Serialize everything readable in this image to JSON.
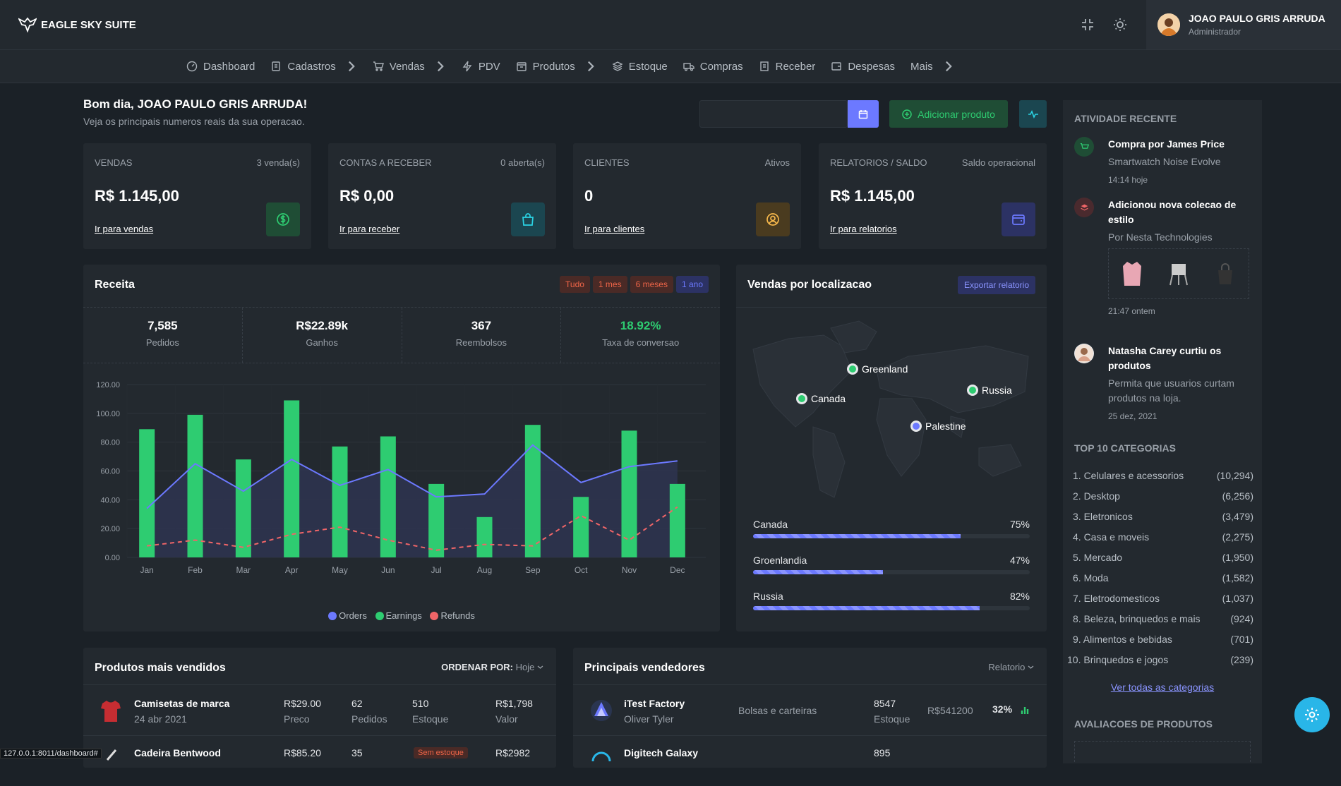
{
  "app": {
    "name": "EAGLE SKY SUITE"
  },
  "user": {
    "name": "JOAO PAULO GRIS ARRUDA",
    "role": "Administrador"
  },
  "nav": [
    {
      "label": "Dashboard",
      "icon": "gauge-icon",
      "sub": false
    },
    {
      "label": "Cadastros",
      "icon": "clipboard-icon",
      "sub": true
    },
    {
      "label": "Vendas",
      "icon": "cart-icon",
      "sub": true
    },
    {
      "label": "PDV",
      "icon": "bolt-icon",
      "sub": false
    },
    {
      "label": "Produtos",
      "icon": "box-icon",
      "sub": true
    },
    {
      "label": "Estoque",
      "icon": "layers-icon",
      "sub": false
    },
    {
      "label": "Compras",
      "icon": "truck-icon",
      "sub": false
    },
    {
      "label": "Receber",
      "icon": "receipt-icon",
      "sub": false
    },
    {
      "label": "Despesas",
      "icon": "wallet-icon",
      "sub": false
    },
    {
      "label": "Mais",
      "icon": "",
      "sub": true
    }
  ],
  "greeting": {
    "title": "Bom dia, JOAO PAULO GRIS ARRUDA!",
    "subtitle": "Veja os principais numeros reais da sua operacao."
  },
  "actions": {
    "add_product": "Adicionar produto"
  },
  "stats": [
    {
      "label": "VENDAS",
      "sub": "3 venda(s)",
      "value": "R$ 1.145,00",
      "link": "Ir para vendas",
      "icon": "dollar-icon",
      "color": "#2ecc71",
      "bg": "#1f4d35"
    },
    {
      "label": "CONTAS A RECEBER",
      "sub": "0 aberta(s)",
      "value": "R$ 0,00",
      "link": "Ir para receber",
      "icon": "bag-icon",
      "color": "#2bd3e4",
      "bg": "#1b4650"
    },
    {
      "label": "CLIENTES",
      "sub": "Ativos",
      "value": "0",
      "link": "Ir para clientes",
      "icon": "user-circle-icon",
      "color": "#f7b84b",
      "bg": "#4a3b1f"
    },
    {
      "label": "RELATORIOS / SALDO",
      "sub": "Saldo operacional",
      "value": "R$ 1.145,00",
      "link": "Ir para relatorios",
      "icon": "wallet-icon",
      "color": "#6c79ff",
      "bg": "#2c3264"
    }
  ],
  "revenue": {
    "title": "Receita",
    "filters": [
      {
        "label": "Tudo",
        "c": "#f06548",
        "bg": "#4a2a26"
      },
      {
        "label": "1 mes",
        "c": "#f06548",
        "bg": "#4a2a26"
      },
      {
        "label": "6 meses",
        "c": "#f06548",
        "bg": "#4a2a26"
      },
      {
        "label": "1 ano",
        "c": "#6c79ff",
        "bg": "#2c3264"
      }
    ],
    "kpis": [
      {
        "value": "7,585",
        "label": "Pedidos"
      },
      {
        "value": "R$22.89k",
        "label": "Ganhos"
      },
      {
        "value": "367",
        "label": "Reembolsos"
      },
      {
        "value": "18.92%",
        "label": "Taxa de conversao",
        "accent": true
      }
    ]
  },
  "chart_data": {
    "type": "bar",
    "categories": [
      "Jan",
      "Feb",
      "Mar",
      "Apr",
      "May",
      "Jun",
      "Jul",
      "Aug",
      "Sep",
      "Oct",
      "Nov",
      "Dec"
    ],
    "ylim": [
      0,
      120
    ],
    "yticks": [
      "0.00",
      "20.00",
      "40.00",
      "60.00",
      "80.00",
      "100.00",
      "120.00"
    ],
    "series": [
      {
        "name": "Orders",
        "type": "area",
        "color": "#6c79ff",
        "values": [
          34,
          65,
          46,
          68,
          50,
          61,
          42,
          44,
          78,
          52,
          63,
          67
        ]
      },
      {
        "name": "Earnings",
        "type": "bar",
        "color": "#2ecc71",
        "values": [
          89,
          99,
          68,
          109,
          77,
          84,
          51,
          28,
          92,
          42,
          88,
          51
        ]
      },
      {
        "name": "Refunds",
        "type": "line-dashed",
        "color": "#f06568",
        "values": [
          8,
          12,
          7,
          16,
          21,
          12,
          5,
          9,
          8,
          29,
          12,
          35
        ]
      }
    ]
  },
  "location": {
    "title": "Vendas por localizacao",
    "export": "Exportar relatorio",
    "markers": [
      "Greenland",
      "Canada",
      "Russia",
      "Palestine"
    ],
    "rows": [
      {
        "name": "Canada",
        "pct": "75%",
        "v": 0.75
      },
      {
        "name": "Groenlandia",
        "pct": "47%",
        "v": 0.47
      },
      {
        "name": "Russia",
        "pct": "82%",
        "v": 0.82
      }
    ]
  },
  "activity": {
    "title": "ATIVIDADE RECENTE",
    "items": [
      {
        "head": "Compra por James Price",
        "desc": "Smartwatch Noise Evolve",
        "time": "14:14 hoje"
      },
      {
        "head": "Adicionou nova colecao de estilo",
        "desc": "Por Nesta Technologies",
        "time": "21:47 ontem"
      },
      {
        "head": "Natasha Carey curtiu os produtos",
        "desc": "Permita que usuarios curtam produtos na loja.",
        "time": "25 dez, 2021"
      }
    ]
  },
  "categories": {
    "title": "TOP 10 CATEGORIAS",
    "items": [
      {
        "name": "1. Celulares e acessorios",
        "count": "(10,294)"
      },
      {
        "name": "2. Desktop",
        "count": "(6,256)"
      },
      {
        "name": "3. Eletronicos",
        "count": "(3,479)"
      },
      {
        "name": "4. Casa e moveis",
        "count": "(2,275)"
      },
      {
        "name": "5. Mercado",
        "count": "(1,950)"
      },
      {
        "name": "6. Moda",
        "count": "(1,582)"
      },
      {
        "name": "7. Eletrodomesticos",
        "count": "(1,037)"
      },
      {
        "name": "8. Beleza, brinquedos e mais",
        "count": "(924)"
      },
      {
        "name": "9. Alimentos e bebidas",
        "count": "(701)"
      },
      {
        "name": "10. Brinquedos e jogos",
        "count": "(239)"
      }
    ],
    "all": "Ver todas as categorias"
  },
  "reviews": {
    "title": "AVALIACOES DE PRODUTOS"
  },
  "products": {
    "title": "Produtos mais vendidos",
    "sort_label": "ORDENAR POR:",
    "sort_value": "Hoje",
    "rows": [
      {
        "name": "Camisetas de marca",
        "date": "24 abr 2021",
        "price": "R$29.00",
        "price_l": "Preco",
        "orders": "62",
        "orders_l": "Pedidos",
        "stock": "510",
        "stock_l": "Estoque",
        "value": "R$1,798",
        "value_l": "Valor"
      },
      {
        "name": "Cadeira Bentwood",
        "price": "R$85.20",
        "orders": "35",
        "stock_badge": "Sem estoque",
        "value": "R$2982"
      }
    ]
  },
  "sellers": {
    "title": "Principais vendedores",
    "report": "Relatorio",
    "rows": [
      {
        "name": "iTest Factory",
        "owner": "Oliver Tyler",
        "cat": "Bolsas e carteiras",
        "stock": "8547",
        "stock_l": "Estoque",
        "value": "R$541200",
        "pct": "32%"
      },
      {
        "name": "Digitech Galaxy",
        "stock": "895"
      }
    ]
  },
  "statusbar": "127.0.0.1:8011/dashboard#"
}
